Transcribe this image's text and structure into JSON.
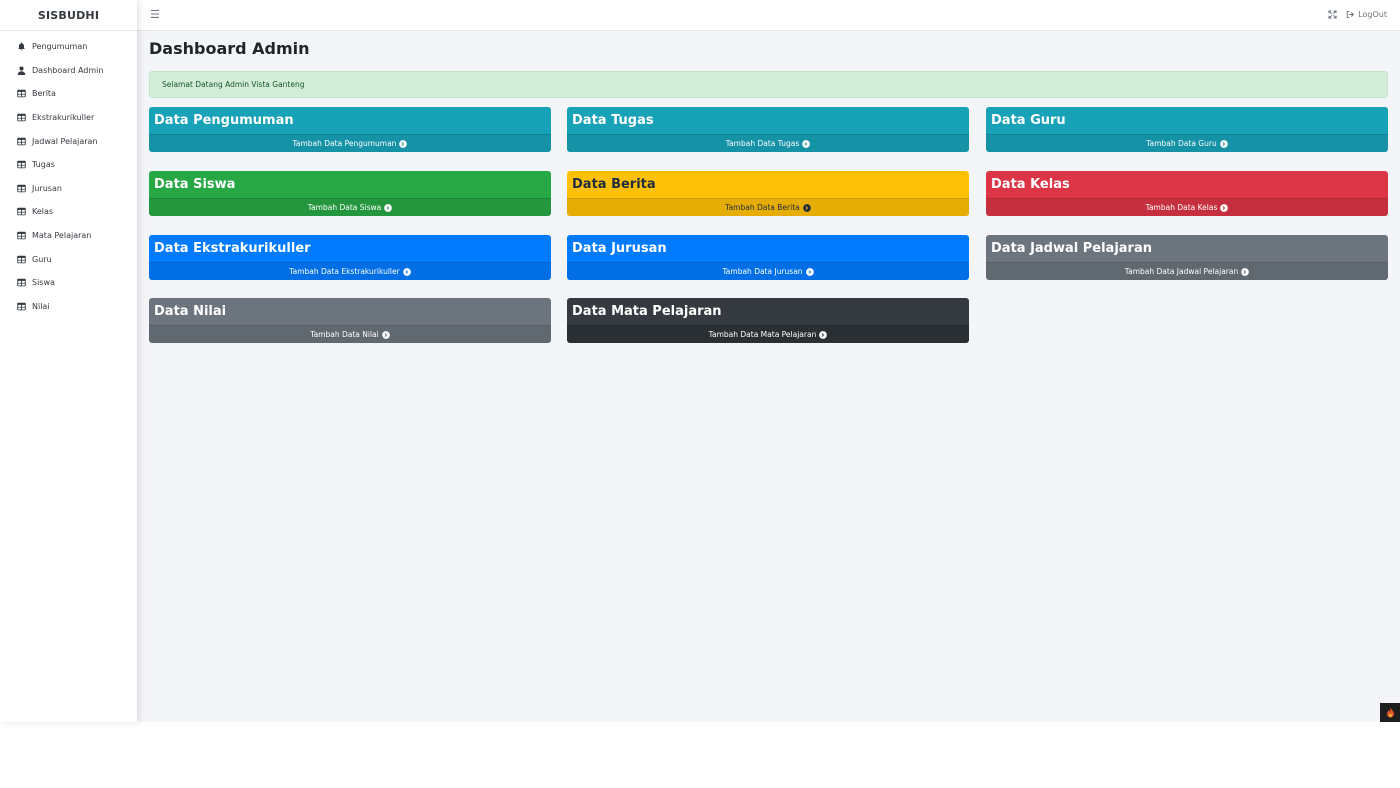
{
  "brand": "SISBUDHI",
  "sidebar": {
    "items": [
      {
        "label": "Pengumuman",
        "icon": "bell-icon"
      },
      {
        "label": "Dashboard Admin",
        "icon": "user-icon"
      },
      {
        "label": "Berita",
        "icon": "table-icon"
      },
      {
        "label": "Ekstrakurikuller",
        "icon": "table-icon"
      },
      {
        "label": "Jadwal Pelajaran",
        "icon": "table-icon"
      },
      {
        "label": "Tugas",
        "icon": "table-icon"
      },
      {
        "label": "Jurusan",
        "icon": "table-icon"
      },
      {
        "label": "Kelas",
        "icon": "table-icon"
      },
      {
        "label": "Mata Pelajaran",
        "icon": "table-icon"
      },
      {
        "label": "Guru",
        "icon": "table-icon"
      },
      {
        "label": "Siswa",
        "icon": "table-icon"
      },
      {
        "label": "Nilai",
        "icon": "table-icon"
      }
    ]
  },
  "topbar": {
    "menu_icon": "hamburger-icon",
    "fullscreen_icon": "expand-icon",
    "logout_label": "LogOut",
    "logout_icon": "sign-out-icon"
  },
  "page": {
    "title": "Dashboard Admin",
    "alert": "Selamat Datang Admin Vista Ganteng"
  },
  "cards": [
    {
      "title": "Data Pengumuman",
      "link": "Tambah Data Pengumuman",
      "variant": "info",
      "color": "#17a2b8"
    },
    {
      "title": "Data Tugas",
      "link": "Tambah Data Tugas",
      "variant": "info",
      "color": "#17a2b8"
    },
    {
      "title": "Data Guru",
      "link": "Tambah Data Guru",
      "variant": "info",
      "color": "#17a2b8"
    },
    {
      "title": "Data Siswa",
      "link": "Tambah Data Siswa",
      "variant": "success",
      "color": "#28a745"
    },
    {
      "title": "Data Berita",
      "link": "Tambah Data Berita",
      "variant": "warning",
      "color": "#ffc107"
    },
    {
      "title": "Data Kelas",
      "link": "Tambah Data Kelas",
      "variant": "danger",
      "color": "#dc3545"
    },
    {
      "title": "Data Ekstrakurikuller",
      "link": "Tambah Data Ekstrakurikuller",
      "variant": "primary",
      "color": "#007bff"
    },
    {
      "title": "Data Jurusan",
      "link": "Tambah Data Jurusan",
      "variant": "primary",
      "color": "#007bff"
    },
    {
      "title": "Data Jadwal Pelajaran",
      "link": "Tambah Data Jadwal Pelajaran",
      "variant": "secondary",
      "color": "#6c757d"
    },
    {
      "title": "Data Nilai",
      "link": "Tambah Data Nilai",
      "variant": "secondary",
      "color": "#6c757d"
    },
    {
      "title": "Data Mata Pelajaran",
      "link": "Tambah Data Mata Pelajaran",
      "variant": "dark",
      "color": "#343a40"
    }
  ],
  "corner_badge_icon": "fire-icon"
}
